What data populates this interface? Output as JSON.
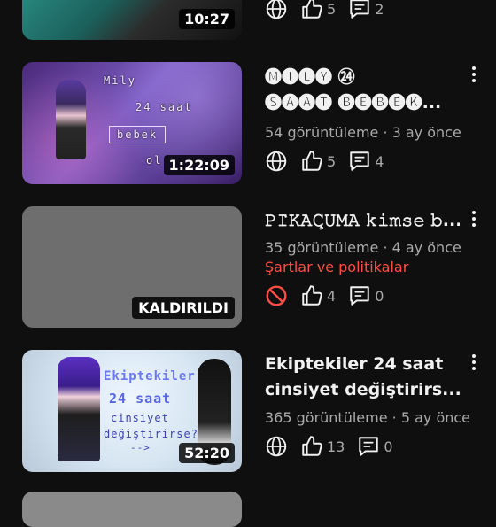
{
  "items": [
    {
      "duration": "10:27",
      "likes": "5",
      "comments": "2"
    },
    {
      "title_line1": "🅜🅘🅛🅨 ㉔",
      "title_line2": "🅢🅐🅐🅣 🅑🅔🅑🅔🅚...",
      "thumb_text": [
        "Mily",
        "24 saat",
        "bebek",
        "ol"
      ],
      "views": "54 görüntüleme · 3 ay önce",
      "duration": "1:22:09",
      "likes": "5",
      "comments": "4"
    },
    {
      "title_line1": "𝙿𝙸̇𝙺𝙰𝙲̧𝚄𝙼𝙰 𝚔𝚒𝚖𝚜𝚎 𝚋...",
      "views": "35 görüntüleme · 4 ay önce",
      "warning": "Şartlar ve politikalar",
      "badge": "KALDIRILDI",
      "likes": "4",
      "comments": "0"
    },
    {
      "title_line1": "𝗘𝗸𝗶𝗽𝘁𝗲𝗸𝗶𝗹𝗲𝗿 𝟮𝟰 𝘀𝗮𝗮𝘁",
      "title_line2": "𝗰𝗶𝗻𝘀𝗶𝘆𝗲𝘁 𝗱𝗲𝗴̆𝗶𝘀̧𝘁𝗶𝗿𝗶𝗿𝘀...",
      "thumb_text": [
        "Ekiptekiler",
        "24 saat",
        "cinsiyet",
        "değiştirirse?",
        "-->"
      ],
      "views": "365 görüntüleme · 5 ay önce",
      "duration": "52:20",
      "likes": "13",
      "comments": "0"
    }
  ],
  "colors": {
    "background": "#0f0f0f",
    "meta": "#aaaaaa",
    "warning": "#ff4e45"
  },
  "icons": [
    "globe-icon",
    "like-icon",
    "comment-icon",
    "blocked-icon",
    "more-vert-icon"
  ]
}
